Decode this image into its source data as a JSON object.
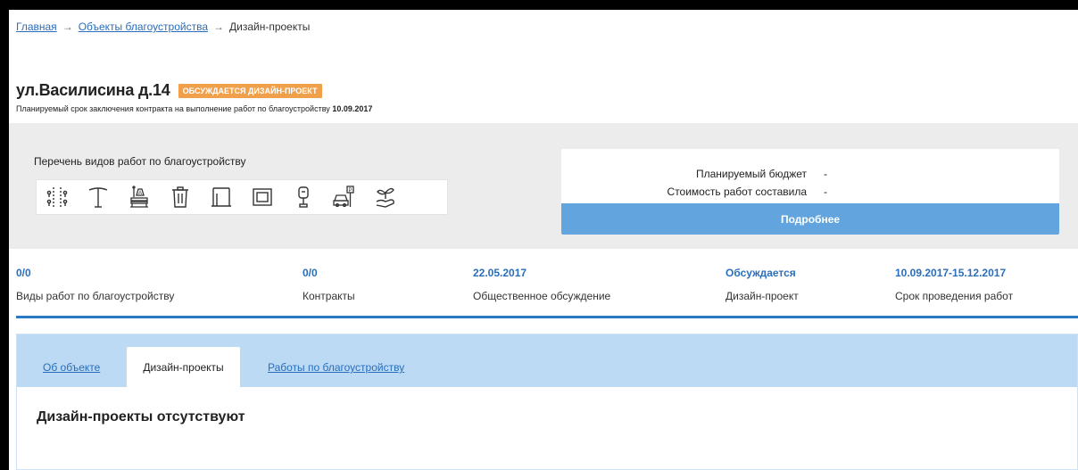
{
  "breadcrumb": {
    "home": "Главная",
    "objects": "Объекты благоустройства",
    "current": "Дизайн-проекты",
    "separator": "→"
  },
  "header": {
    "title": "ул.Василисина д.14",
    "status_badge": "ОБСУЖДАЕТСЯ ДИЗАЙН-ПРОЕКТ",
    "subtitle_text": "Планируемый срок заключения контракта на выполнение работ по благоустройству",
    "subtitle_date": "10.09.2017"
  },
  "works": {
    "label": "Перечень видов работ по благоустройству",
    "icons": [
      "road-markings-icon",
      "street-lamp-icon",
      "bench-icon",
      "trash-bin-icon",
      "fence-icon",
      "playground-frame-icon",
      "parking-meter-icon",
      "parking-car-icon",
      "landscaping-plant-icon"
    ]
  },
  "budget": {
    "planned_label": "Планируемый бюджет",
    "planned_value": "-",
    "cost_label": "Стоимость работ составила",
    "cost_value": "-",
    "more_button": "Подробнее"
  },
  "stats": [
    {
      "value": "0/0",
      "label": "Виды работ по благоустройству"
    },
    {
      "value": "0/0",
      "label": "Контракты"
    },
    {
      "value": "22.05.2017",
      "label": "Общественное обсуждение"
    },
    {
      "value": "Обсуждается",
      "label": "Дизайн-проект"
    },
    {
      "value": "10.09.2017-15.12.2017",
      "label": "Срок проведения работ"
    }
  ],
  "tabs": {
    "about": "Об объекте",
    "design": "Дизайн-проекты",
    "works": "Работы по благоустройству"
  },
  "empty_message": "Дизайн-проекты отсутствуют",
  "colors": {
    "accent_blue": "#2a79c4",
    "link_blue": "#2a6ebb",
    "badge_orange": "#f0a04b",
    "button_blue": "#62a5de",
    "tab_bar": "#bcdaf4",
    "panel_grey": "#ececec"
  }
}
